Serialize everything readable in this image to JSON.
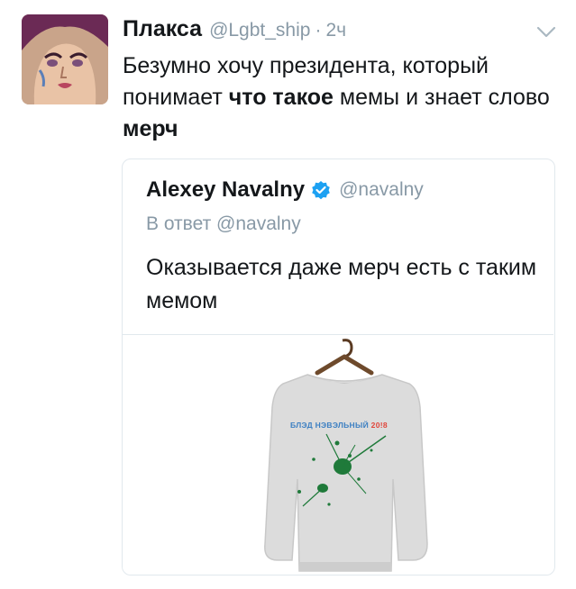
{
  "tweet": {
    "author_name": "Плакса",
    "author_handle": "@Lgbt_ship",
    "separator": "·",
    "time": "2ч",
    "text_parts": [
      "Безумно хочу президента, который понимает ",
      "что такое",
      " мемы и знает слово ",
      "мерч"
    ]
  },
  "quoted": {
    "author_name": "Alexey Navalny",
    "author_handle": "@navalny",
    "reply_to": "В ответ @navalny",
    "text": "Оказывается даже мерч есть с таким мемом",
    "media": {
      "sweater_print": "БЛЭД НЭВЭЛЬНЫЙ 20!8",
      "print_color_text": "#3c7fc2",
      "print_color_year": "#e0453a",
      "splatter_color": "#1f7a3a"
    }
  },
  "colors": {
    "text": "#14171a",
    "secondary": "#8899a6",
    "border": "#e1e8ed",
    "verified": "#1da1f2"
  },
  "icons": {
    "caret": "chevron-down-icon",
    "verified": "verified-badge-icon"
  }
}
